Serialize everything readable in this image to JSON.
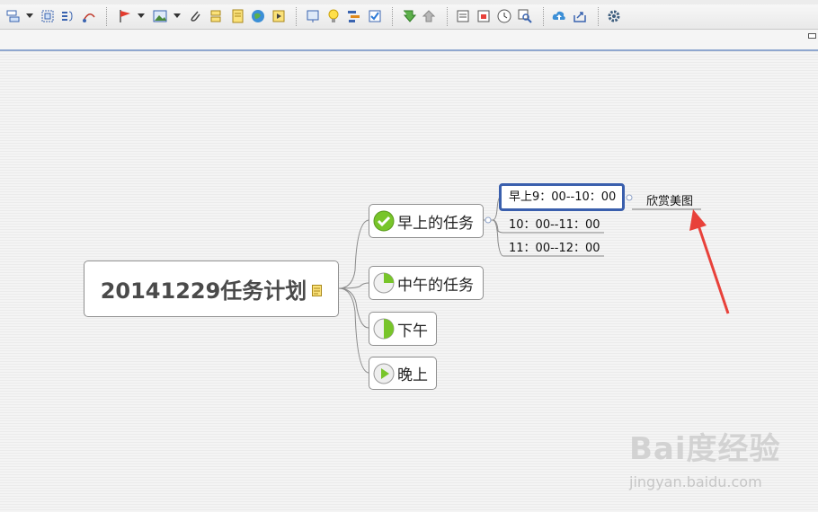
{
  "toolbar": {
    "icons": [
      "insert-topic-icon",
      "insert-subtopic-icon",
      "boundary-icon",
      "summary-icon",
      "relationship-icon",
      "flag-icon",
      "image-icon",
      "attachment-icon",
      "label-icon",
      "note-icon",
      "hyperlink-icon",
      "audio-icon",
      "presentation-icon",
      "lightbulb-icon",
      "gantt-icon",
      "task-icon",
      "drill-down-icon",
      "drill-up-icon",
      "outline-icon",
      "spreadsheet-icon",
      "clock-icon",
      "zoom-icon",
      "upload-icon",
      "export-icon",
      "settings-icon"
    ]
  },
  "mindmap": {
    "central": {
      "title": "20141229任务计划",
      "note": true
    },
    "branches": [
      {
        "label": "早上的任务",
        "icon": "checkmark-icon",
        "progress": 1.0,
        "color": "#78c52a"
      },
      {
        "label": "中午的任务",
        "icon": "progress-quarter-icon",
        "progress": 0.25,
        "color": "#78c52a"
      },
      {
        "label": "下午",
        "icon": "progress-half-icon",
        "progress": 0.5,
        "color": "#78c52a"
      },
      {
        "label": "晚上",
        "icon": "play-icon",
        "progress": 0.0,
        "color": "#78c52a"
      }
    ],
    "morning_subtopics": [
      "早上9：00--10：00",
      "10：00--11：00",
      "11：00--12：00"
    ],
    "leaf": "欣赏美图"
  },
  "annotation": {
    "arrow_color": "#e8413a"
  },
  "watermark": {
    "text": "Bai度经验",
    "url": "jingyan.baidu.com"
  }
}
